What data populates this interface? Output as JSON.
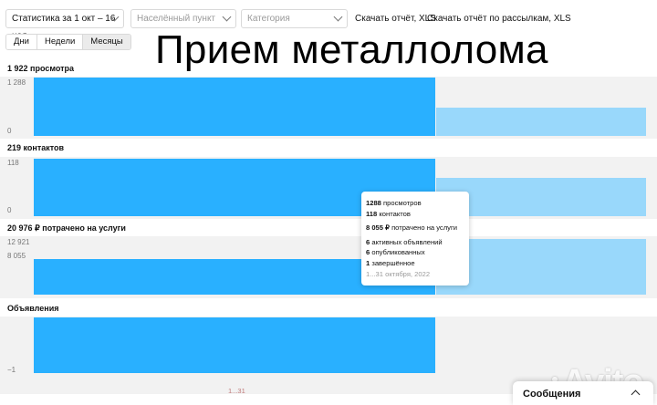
{
  "filters": {
    "period": "Статистика за 1 окт – 16 ноя",
    "locality_placeholder": "Населённый пункт",
    "category_placeholder": "Категория"
  },
  "links": {
    "download_report": "Скачать отчёт, XLS",
    "download_mailing": "Скачать отчёт по рассылкам, XLS"
  },
  "granularity": {
    "options": [
      "Дни",
      "Недели",
      "Месяцы"
    ],
    "active": "Месяцы"
  },
  "overlay_title": "Прием металлолома",
  "sections": {
    "views": {
      "title": "1 922 просмотра",
      "tick_top": "1 288",
      "tick_bottom": "0"
    },
    "contacts": {
      "title": "219 контактов",
      "tick_top": "118",
      "tick_bottom": "0"
    },
    "spent": {
      "title": "20 976 ₽ потрачено на услуги",
      "tick_top": "12 921",
      "tick_mid": "8 055"
    },
    "listings": {
      "title": "Объявления",
      "tick_bottom": "−1"
    }
  },
  "tooltip": {
    "views_num": "1288",
    "views_txt": " просмотров",
    "contacts_num": "118",
    "contacts_txt": " контактов",
    "spent_num": "8 055 ₽",
    "spent_txt": " потрачено на услуги",
    "active_num": "6",
    "active_txt": " активных объявлений",
    "published_num": "6",
    "published_txt": " опубликованных",
    "finished_num": "1",
    "finished_txt": " завершённое",
    "date": "1...31 октября, 2022"
  },
  "x_label": "1...31",
  "watermark": "Avito",
  "messages": {
    "label": "Сообщения"
  },
  "colors": {
    "bar_main": "#29b0ff",
    "bar_light": "#99d8fb",
    "band": "#f2f2f2"
  },
  "icons": [
    "chevron-down-icon",
    "chevron-up-icon"
  ]
}
